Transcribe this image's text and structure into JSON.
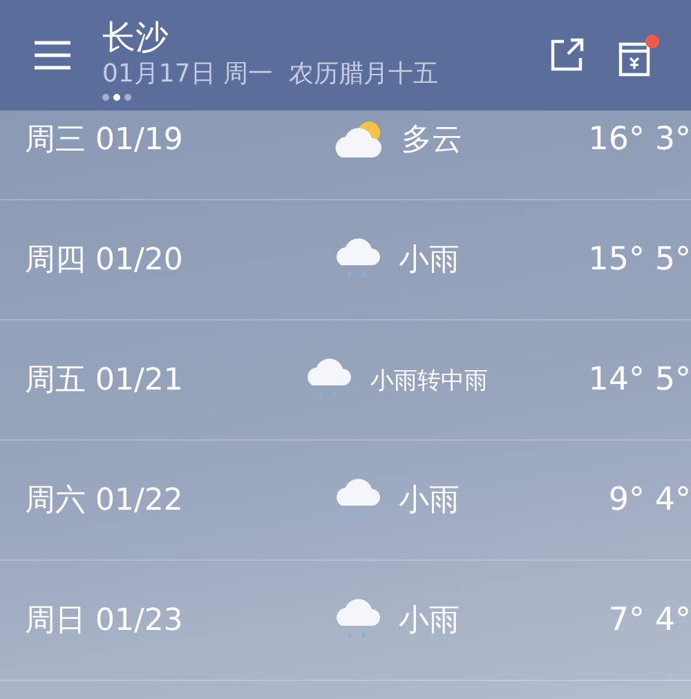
{
  "header": {
    "city": "长沙",
    "date_line": "01月17日 周一  农历腊月十五",
    "pages": [
      {
        "selected": false
      },
      {
        "selected": true
      },
      {
        "selected": false
      }
    ],
    "gift_badge": true
  },
  "forecast": [
    {
      "day": "周三",
      "date": "01/19",
      "kind": "cloudy_sun",
      "condition": "多云",
      "high": "16°",
      "low": "3°"
    },
    {
      "day": "周四",
      "date": "01/20",
      "kind": "rain",
      "condition": "小雨",
      "high": "15°",
      "low": "5°"
    },
    {
      "day": "周五",
      "date": "01/21",
      "kind": "rain",
      "condition": "小雨转中雨",
      "high": "14°",
      "low": "5°"
    },
    {
      "day": "周六",
      "date": "01/22",
      "kind": "rain",
      "condition": "小雨",
      "high": "9°",
      "low": "4°"
    },
    {
      "day": "周日",
      "date": "01/23",
      "kind": "rain",
      "condition": "小雨",
      "high": "7°",
      "low": "4°"
    }
  ]
}
